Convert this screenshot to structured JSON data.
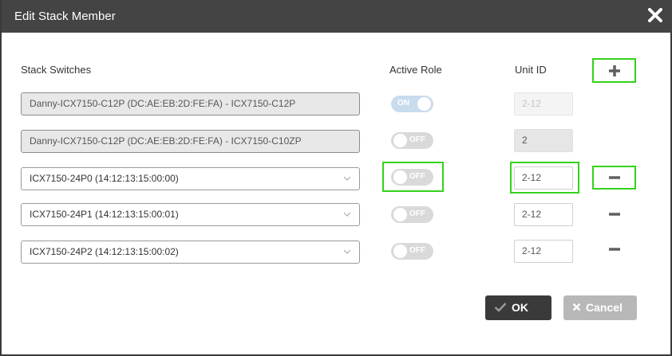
{
  "dialog": {
    "title": "Edit Stack Member",
    "close_icon": "close-icon"
  },
  "headers": {
    "stack_switches": "Stack Switches",
    "active_role": "Active Role",
    "unit_id": "Unit ID"
  },
  "rows": [
    {
      "switch": "Danny-ICX7150-C12P (DC:AE:EB:2D:FE:FA) - ICX7150-C12P",
      "switch_type": "readonly",
      "role": "ON",
      "role_state": "on",
      "unit_id": "2-12",
      "unit_state": "readonly-placeholder",
      "action": "none"
    },
    {
      "switch": "Danny-ICX7150-C12P (DC:AE:EB:2D:FE:FA) - ICX7150-C10ZP",
      "switch_type": "readonly",
      "role": "OFF",
      "role_state": "off",
      "unit_id": "2",
      "unit_state": "disabled",
      "action": "none"
    },
    {
      "switch": "ICX7150-24P0 (14:12:13:15:00:00)",
      "switch_type": "select",
      "role": "OFF",
      "role_state": "off",
      "unit_id": "2-12",
      "unit_state": "editable",
      "action": "remove",
      "highlighted": true
    },
    {
      "switch": "ICX7150-24P1 (14:12:13:15:00:01)",
      "switch_type": "select",
      "role": "OFF",
      "role_state": "off",
      "unit_id": "2-12",
      "unit_state": "editable",
      "action": "remove"
    },
    {
      "switch": "ICX7150-24P2 (14:12:13:15:00:02)",
      "switch_type": "select",
      "role": "OFF",
      "role_state": "off",
      "unit_id": "2-12",
      "unit_state": "editable",
      "action": "remove"
    }
  ],
  "buttons": {
    "ok": "OK",
    "cancel": "Cancel"
  },
  "icons": {
    "add": "plus-icon",
    "remove": "minus-icon",
    "dropdown": "chevron-down-icon",
    "ok": "check-icon",
    "cancel": "x-icon"
  },
  "colors": {
    "titlebar": "#444444",
    "highlight": "#33d21b",
    "toggle_on": "#c9dcee",
    "toggle_off": "#d9d9d9",
    "ok_button": "#3a3a3a",
    "cancel_button": "#b8b8b8"
  }
}
